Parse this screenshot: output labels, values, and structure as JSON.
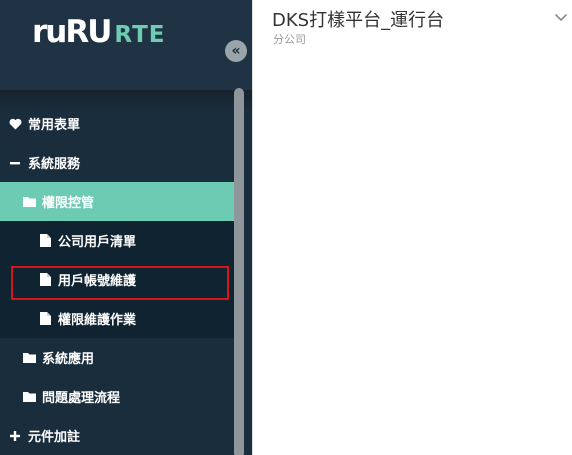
{
  "brand": {
    "logo_mark": "ruRU",
    "logo_text": "RTE"
  },
  "sidebar": {
    "collapse_glyph": "«",
    "items": [
      {
        "label": "常用表單",
        "icon": "heart-icon"
      },
      {
        "label": "系統服務",
        "icon": "minus-icon"
      },
      {
        "label": "權限控管",
        "icon": "folder-icon"
      },
      {
        "label": "公司用戶清單",
        "icon": "file-icon"
      },
      {
        "label": "用戶帳號維護",
        "icon": "file-icon"
      },
      {
        "label": "權限維護作業",
        "icon": "file-icon"
      },
      {
        "label": "系統應用",
        "icon": "folder-icon"
      },
      {
        "label": "問題處理流程",
        "icon": "folder-icon"
      },
      {
        "label": "元件加註",
        "icon": "plus-icon"
      }
    ]
  },
  "header": {
    "title": "DKS打樣平台_運行台",
    "subtitle": "分公司",
    "dropdown_icon": "chevron-down-icon"
  },
  "colors": {
    "sidebar_bg": "#1a2d3c",
    "active_bg": "#6dcab3",
    "highlight_border": "#d8141c"
  }
}
